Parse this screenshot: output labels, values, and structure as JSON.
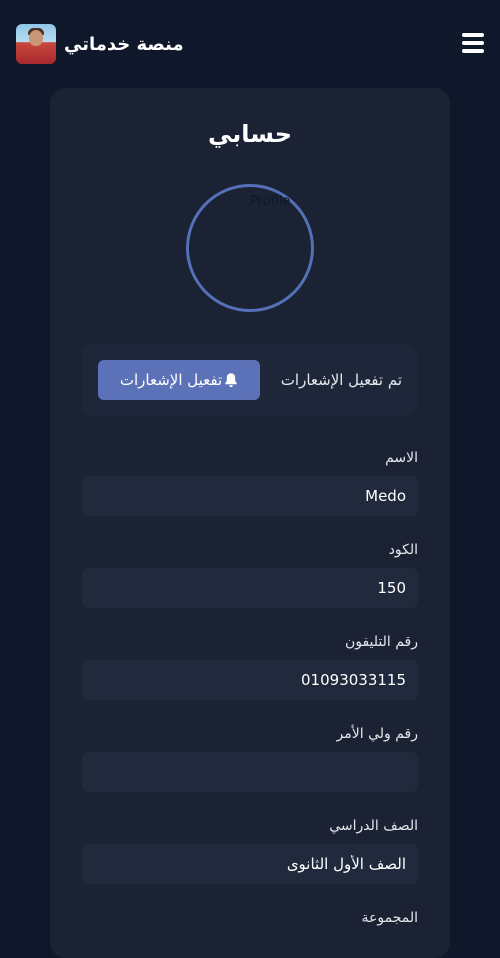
{
  "header": {
    "brand_name": "منصة خدماتي",
    "logo_icon": "user-photo",
    "menu_icon": "hamburger-menu-icon"
  },
  "card": {
    "title": "حسابي",
    "avatar_alt": "Profile",
    "notifications": {
      "status": "تم تفعيل الإشعارات",
      "button_label": "تفعيل الإشعارات",
      "button_icon": "bell-icon"
    },
    "fields": {
      "name": {
        "label": "الاسم",
        "value": "Medo"
      },
      "code": {
        "label": "الكود",
        "value": "150"
      },
      "phone": {
        "label": "رقم التليفون",
        "value": "01093033115"
      },
      "guardian_phone": {
        "label": "رقم ولي الأمر",
        "value": ""
      },
      "grade": {
        "label": "الصف الدراسي",
        "value": "الصف الأول الثانوى"
      },
      "group": {
        "label": "المجموعة"
      }
    }
  },
  "colors": {
    "background": "#0f172a",
    "card": "#1a2233",
    "field": "#202a3c",
    "accent": "#5c72b8",
    "avatar_ring": "#5470b8"
  }
}
